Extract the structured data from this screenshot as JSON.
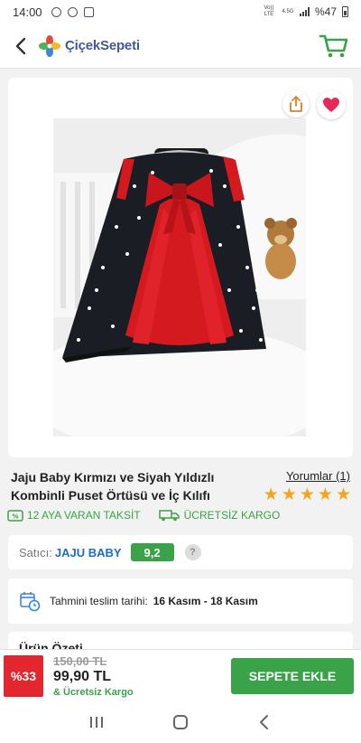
{
  "status_bar": {
    "time": "14:00",
    "network_label": "Vo)) LTE",
    "network_speed": "4.5G",
    "battery": "%47"
  },
  "header": {
    "brand_name": "ÇiçekSepeti"
  },
  "product": {
    "title": "Jaju Baby Kırmızı ve Siyah Yıldızlı Kombinli Puset Örtüsü ve İç Kılıfı",
    "reviews_label": "Yorumlar (1)",
    "rating": 5,
    "stars": [
      "★",
      "★",
      "★",
      "★",
      "★"
    ]
  },
  "promos": {
    "installment": "12 AYA VARAN TAKSİT",
    "shipping": "ÜCRETSİZ KARGO"
  },
  "seller": {
    "label": "Satıcı:",
    "name": "JAJU BABY",
    "score": "9,2",
    "info": "?"
  },
  "delivery": {
    "label": "Tahmini teslim tarihi:",
    "dates": "16 Kasım - 18 Kasım"
  },
  "summary": {
    "title": "Ürün Özeti"
  },
  "buy_bar": {
    "discount": "%33",
    "old_price": "150,00 TL",
    "new_price": "99,90 TL",
    "free_shipping": "& Ücretsiz Kargo",
    "add_to_cart": "SEPETE EKLE"
  },
  "colors": {
    "accent_green": "#3aa248",
    "discount_red": "#e4262e",
    "seller_blue": "#1a6fc7",
    "star_orange": "#f3a51e",
    "favorite_pink": "#e8275a"
  }
}
